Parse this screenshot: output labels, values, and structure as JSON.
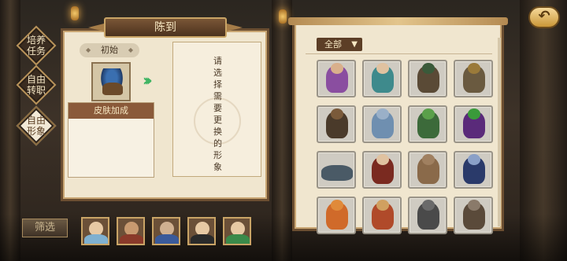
{
  "left_menu": [
    {
      "label": "培养\n任务",
      "active": false
    },
    {
      "label": "自由\n转职",
      "active": false
    },
    {
      "label": "自由\n形象",
      "active": true
    }
  ],
  "panel": {
    "title": "陈到",
    "initial_label": "初始",
    "skin_bonus_header": "皮肤加成",
    "select_prompt": "请\n选\n择\n需\n要\n更\n换\n的\n形\n象"
  },
  "filter": {
    "selected": "全部"
  },
  "bottom": {
    "filter_button": "筛选"
  },
  "icons": {
    "back": "back-arrow-icon",
    "arrow": "double-chevron-right-icon",
    "dropdown": "chevron-down-icon"
  },
  "colors": {
    "panel_bg": "#f0e6cf",
    "frame": "#6b4e31",
    "accent_green": "#3fb463",
    "header_brown": "#8a5a3a"
  }
}
